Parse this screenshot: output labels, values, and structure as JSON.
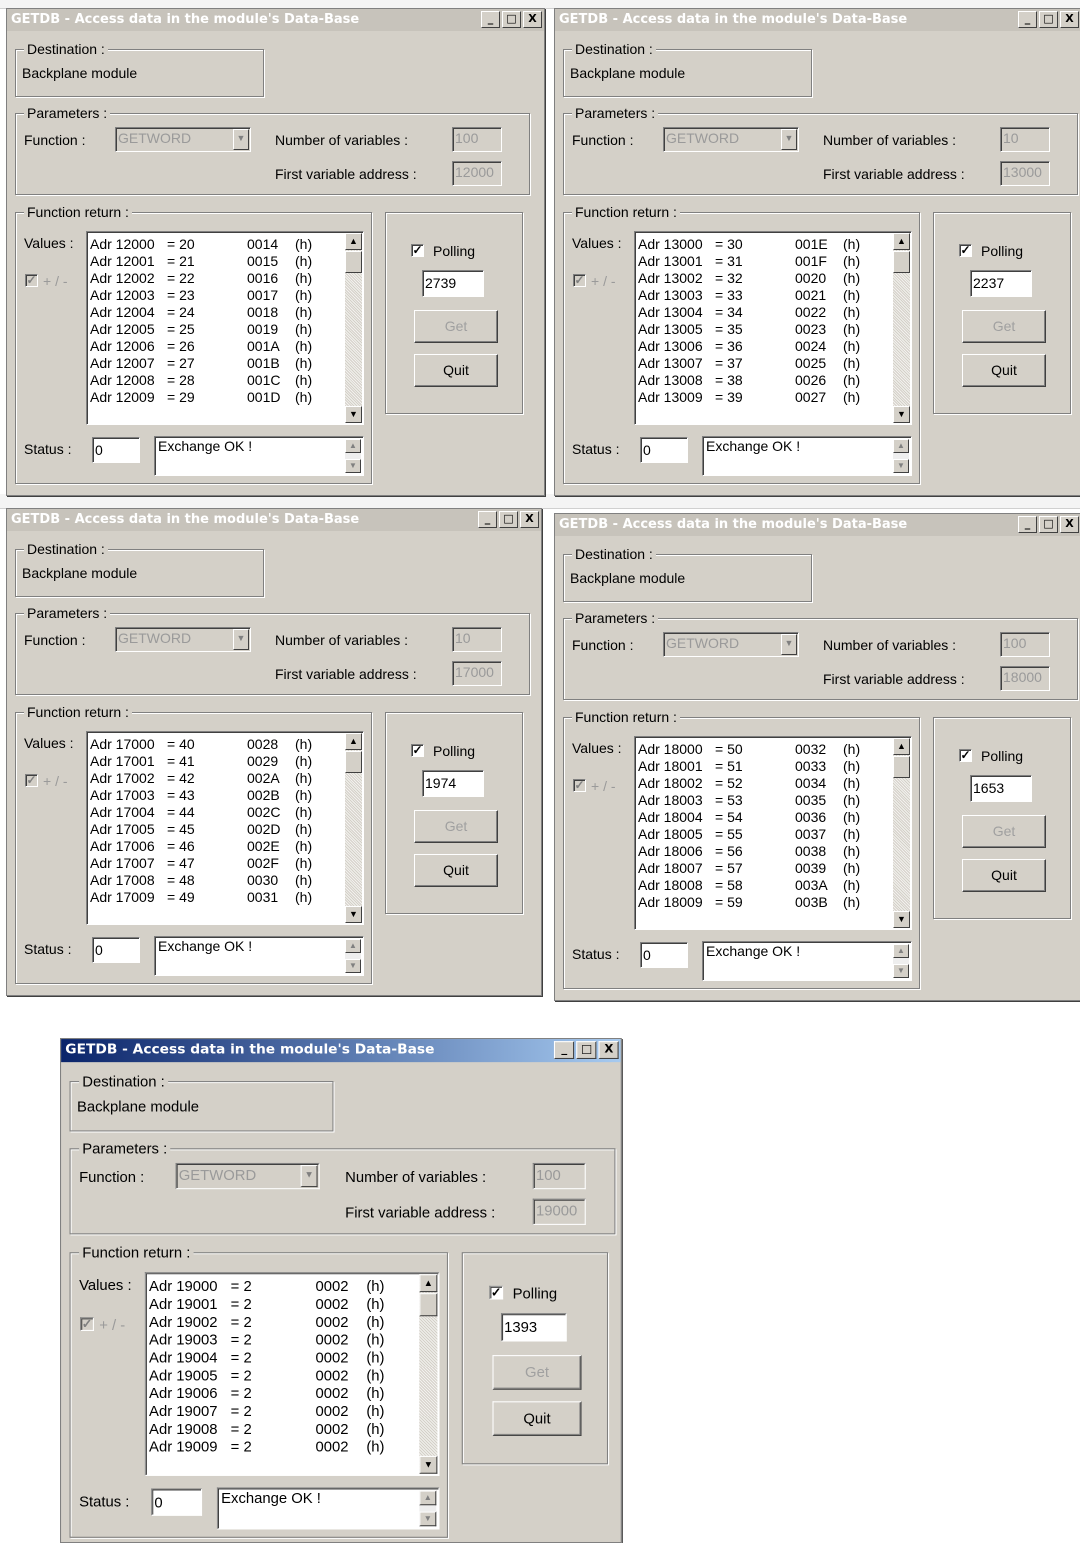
{
  "app": {
    "title": "GETDB - Access data in the module's Data-Base",
    "window_buttons": {
      "minimize": "_",
      "maximize": "□",
      "close": "X"
    }
  },
  "labels": {
    "destination": "Destination :",
    "parameters": "Parameters :",
    "function": "Function :",
    "num_vars": "Number of variables :",
    "first_addr": "First variable address :",
    "function_return": "Function return :",
    "values": "Values :",
    "plusminus": "+ / -",
    "status": "Status :",
    "polling": "Polling",
    "get": "Get",
    "quit": "Quit"
  },
  "windows": [
    {
      "destination": "Backplane module",
      "function": "GETWORD",
      "num_vars": "100",
      "first_addr": "12000",
      "polling_checked": true,
      "polling_value": "2739",
      "status_code": "0",
      "status_text": "Exchange OK !",
      "active": false,
      "rows": [
        {
          "adr": "Adr 12000",
          "val": "= 20",
          "hex": "0014",
          "h": "(h)"
        },
        {
          "adr": "Adr 12001",
          "val": "= 21",
          "hex": "0015",
          "h": "(h)"
        },
        {
          "adr": "Adr 12002",
          "val": "= 22",
          "hex": "0016",
          "h": "(h)"
        },
        {
          "adr": "Adr 12003",
          "val": "= 23",
          "hex": "0017",
          "h": "(h)"
        },
        {
          "adr": "Adr 12004",
          "val": "= 24",
          "hex": "0018",
          "h": "(h)"
        },
        {
          "adr": "Adr 12005",
          "val": "= 25",
          "hex": "0019",
          "h": "(h)"
        },
        {
          "adr": "Adr 12006",
          "val": "= 26",
          "hex": "001A",
          "h": "(h)"
        },
        {
          "adr": "Adr 12007",
          "val": "= 27",
          "hex": "001B",
          "h": "(h)"
        },
        {
          "adr": "Adr 12008",
          "val": "= 28",
          "hex": "001C",
          "h": "(h)"
        },
        {
          "adr": "Adr 12009",
          "val": "= 29",
          "hex": "001D",
          "h": "(h)"
        }
      ]
    },
    {
      "destination": "Backplane module",
      "function": "GETWORD",
      "num_vars": "10",
      "first_addr": "13000",
      "polling_checked": true,
      "polling_value": "2237",
      "status_code": "0",
      "status_text": "Exchange OK !",
      "active": false,
      "rows": [
        {
          "adr": "Adr 13000",
          "val": "= 30",
          "hex": "001E",
          "h": "(h)"
        },
        {
          "adr": "Adr 13001",
          "val": "= 31",
          "hex": "001F",
          "h": "(h)"
        },
        {
          "adr": "Adr 13002",
          "val": "= 32",
          "hex": "0020",
          "h": "(h)"
        },
        {
          "adr": "Adr 13003",
          "val": "= 33",
          "hex": "0021",
          "h": "(h)"
        },
        {
          "adr": "Adr 13004",
          "val": "= 34",
          "hex": "0022",
          "h": "(h)"
        },
        {
          "adr": "Adr 13005",
          "val": "= 35",
          "hex": "0023",
          "h": "(h)"
        },
        {
          "adr": "Adr 13006",
          "val": "= 36",
          "hex": "0024",
          "h": "(h)"
        },
        {
          "adr": "Adr 13007",
          "val": "= 37",
          "hex": "0025",
          "h": "(h)"
        },
        {
          "adr": "Adr 13008",
          "val": "= 38",
          "hex": "0026",
          "h": "(h)"
        },
        {
          "adr": "Adr 13009",
          "val": "= 39",
          "hex": "0027",
          "h": "(h)"
        }
      ]
    },
    {
      "destination": "Backplane module",
      "function": "GETWORD",
      "num_vars": "10",
      "first_addr": "17000",
      "polling_checked": true,
      "polling_value": "1974",
      "status_code": "0",
      "status_text": "Exchange OK !",
      "active": false,
      "rows": [
        {
          "adr": "Adr 17000",
          "val": "= 40",
          "hex": "0028",
          "h": "(h)"
        },
        {
          "adr": "Adr 17001",
          "val": "= 41",
          "hex": "0029",
          "h": "(h)"
        },
        {
          "adr": "Adr 17002",
          "val": "= 42",
          "hex": "002A",
          "h": "(h)"
        },
        {
          "adr": "Adr 17003",
          "val": "= 43",
          "hex": "002B",
          "h": "(h)"
        },
        {
          "adr": "Adr 17004",
          "val": "= 44",
          "hex": "002C",
          "h": "(h)"
        },
        {
          "adr": "Adr 17005",
          "val": "= 45",
          "hex": "002D",
          "h": "(h)"
        },
        {
          "adr": "Adr 17006",
          "val": "= 46",
          "hex": "002E",
          "h": "(h)"
        },
        {
          "adr": "Adr 17007",
          "val": "= 47",
          "hex": "002F",
          "h": "(h)"
        },
        {
          "adr": "Adr 17008",
          "val": "= 48",
          "hex": "0030",
          "h": "(h)"
        },
        {
          "adr": "Adr 17009",
          "val": "= 49",
          "hex": "0031",
          "h": "(h)"
        }
      ]
    },
    {
      "destination": "Backplane module",
      "function": "GETWORD",
      "num_vars": "100",
      "first_addr": "18000",
      "polling_checked": true,
      "polling_value": "1653",
      "status_code": "0",
      "status_text": "Exchange OK !",
      "active": false,
      "rows": [
        {
          "adr": "Adr 18000",
          "val": "= 50",
          "hex": "0032",
          "h": "(h)"
        },
        {
          "adr": "Adr 18001",
          "val": "= 51",
          "hex": "0033",
          "h": "(h)"
        },
        {
          "adr": "Adr 18002",
          "val": "= 52",
          "hex": "0034",
          "h": "(h)"
        },
        {
          "adr": "Adr 18003",
          "val": "= 53",
          "hex": "0035",
          "h": "(h)"
        },
        {
          "adr": "Adr 18004",
          "val": "= 54",
          "hex": "0036",
          "h": "(h)"
        },
        {
          "adr": "Adr 18005",
          "val": "= 55",
          "hex": "0037",
          "h": "(h)"
        },
        {
          "adr": "Adr 18006",
          "val": "= 56",
          "hex": "0038",
          "h": "(h)"
        },
        {
          "adr": "Adr 18007",
          "val": "= 57",
          "hex": "0039",
          "h": "(h)"
        },
        {
          "adr": "Adr 18008",
          "val": "= 58",
          "hex": "003A",
          "h": "(h)"
        },
        {
          "adr": "Adr 18009",
          "val": "= 59",
          "hex": "003B",
          "h": "(h)"
        }
      ]
    },
    {
      "destination": "Backplane module",
      "function": "GETWORD",
      "num_vars": "100",
      "first_addr": "19000",
      "polling_checked": true,
      "polling_value": "1393",
      "status_code": "0",
      "status_text": "Exchange OK !",
      "active": true,
      "rows": [
        {
          "adr": "Adr 19000",
          "val": "= 2",
          "hex": "0002",
          "h": "(h)"
        },
        {
          "adr": "Adr 19001",
          "val": "= 2",
          "hex": "0002",
          "h": "(h)"
        },
        {
          "adr": "Adr 19002",
          "val": "= 2",
          "hex": "0002",
          "h": "(h)"
        },
        {
          "adr": "Adr 19003",
          "val": "= 2",
          "hex": "0002",
          "h": "(h)"
        },
        {
          "adr": "Adr 19004",
          "val": "= 2",
          "hex": "0002",
          "h": "(h)"
        },
        {
          "adr": "Adr 19005",
          "val": "= 2",
          "hex": "0002",
          "h": "(h)"
        },
        {
          "adr": "Adr 19006",
          "val": "= 2",
          "hex": "0002",
          "h": "(h)"
        },
        {
          "adr": "Adr 19007",
          "val": "= 2",
          "hex": "0002",
          "h": "(h)"
        },
        {
          "adr": "Adr 19008",
          "val": "= 2",
          "hex": "0002",
          "h": "(h)"
        },
        {
          "adr": "Adr 19009",
          "val": "= 2",
          "hex": "0002",
          "h": "(h)"
        }
      ]
    }
  ]
}
